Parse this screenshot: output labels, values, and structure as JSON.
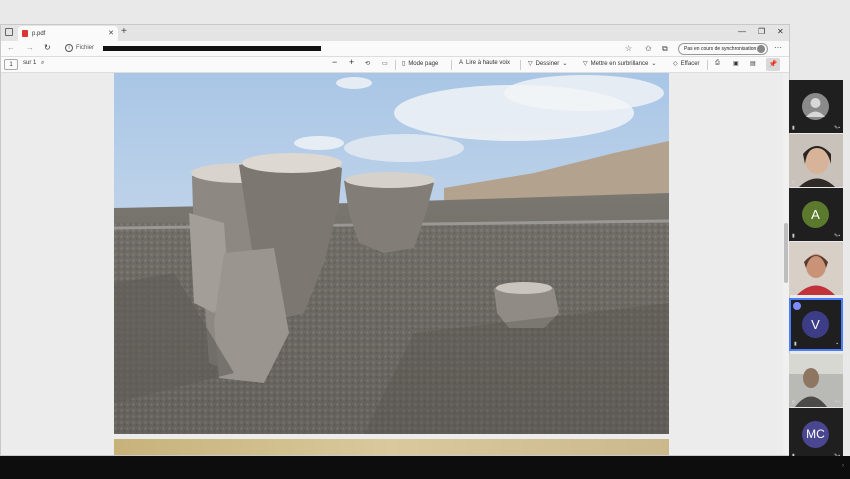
{
  "browser": {
    "tab_title": "p.pdf",
    "new_tab": "+",
    "window_controls": [
      "—",
      "❐",
      "✕"
    ],
    "nav": {
      "back": "←",
      "forward": "→",
      "reload": "↻"
    },
    "file_label": "Fichier",
    "sync_label": "Pas en cours de synchronisation",
    "more": "···"
  },
  "pdf_toolbar": {
    "page_value": "1",
    "page_of": "sur 1",
    "zoom_out": "−",
    "zoom_in": "+",
    "mode_page": "Mode page",
    "read_aloud": "Lire à haute voix",
    "draw": "Dessiner",
    "highlight": "Mettre en surbrillance",
    "erase": "Effacer"
  },
  "participants": [
    {
      "kind": "avatar",
      "initials": "",
      "color": "#8a8a8a"
    },
    {
      "kind": "video"
    },
    {
      "kind": "avatar",
      "initials": "A",
      "color": "#5b7a2e"
    },
    {
      "kind": "video"
    },
    {
      "kind": "avatar",
      "initials": "V",
      "color": "#3d3c86",
      "speaking": true
    },
    {
      "kind": "video"
    },
    {
      "kind": "avatar",
      "initials": "MC",
      "color": "#4a4690"
    }
  ]
}
